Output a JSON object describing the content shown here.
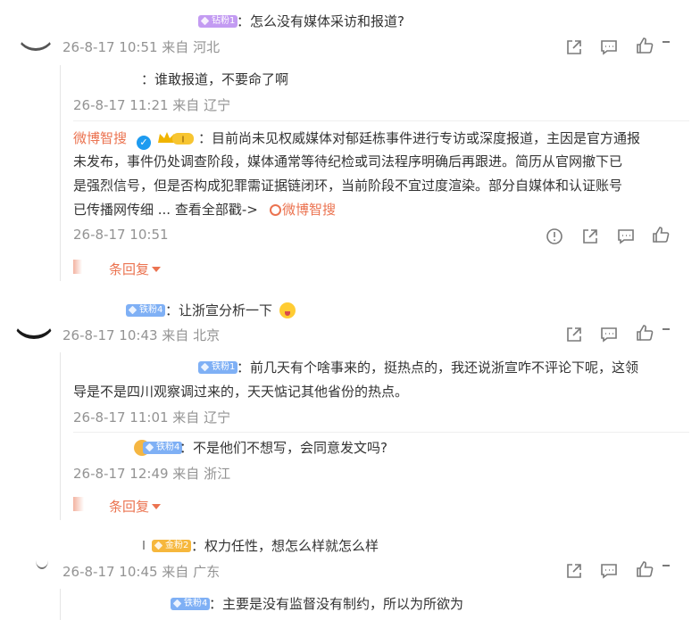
{
  "comments": [
    {
      "badge": "钻粉1",
      "text": "：怎么没有媒体采访和报道?",
      "meta": "26-8-17 10:51 来自 河北",
      "replies": [
        {
          "text": "：谁敢报道，不要命了啊",
          "meta": "26-8-17 11:21 来自 辽宁"
        },
        {
          "author": "微博智搜",
          "text_lines": [
            "：目前尚未见权威媒体对郁廷栋事件进行专访或深度报道，主因是官方通报",
            "未发布，事件仍处调查阶段，媒体通常等待纪检或司法程序明确后再跟进。简历从官网撤下已",
            "是强烈信号，但是否构成犯罪需证据链闭环，当前阶段不宜过度渲染。部分自媒体和认证账号",
            "已传播网传细 ... 查看全部戳->"
          ],
          "link": "微博智搜",
          "meta": "26-8-17 10:51",
          "crown_level": "I"
        }
      ],
      "more_replies": "条回复"
    },
    {
      "badge": "铁粉4",
      "text": "：让浙宣分析一下",
      "meta": "26-8-17 10:43 来自 北京",
      "replies": [
        {
          "badge": "铁粉1",
          "text_lines": [
            "：前几天有个啥事来的，挺热点的，我还说浙宣咋不评论下呢，这领",
            "导是不是四川观察调过来的，天天惦记其他省份的热点。"
          ],
          "meta": "26-8-17 11:01 来自 辽宁"
        },
        {
          "badge": "铁粉4",
          "text": "：不是他们不想写，会同意发文吗?",
          "meta": "26-8-17 12:49 来自 浙江"
        }
      ],
      "more_replies": "条回复"
    },
    {
      "badge": "金粉2",
      "text": "：权力任性，想怎么样就怎么样",
      "meta": "26-8-17 10:45 来自 广东",
      "replies": [
        {
          "badge": "铁粉4",
          "text": "：主要是没有监督没有制约，所以为所欲为"
        }
      ]
    }
  ],
  "icons": [
    "share-icon",
    "comment-icon",
    "like-icon",
    "report-icon"
  ],
  "colors": {
    "accent": "#eb7350",
    "meta": "#939393",
    "text": "#333333",
    "verify": "#1d9bf0"
  }
}
